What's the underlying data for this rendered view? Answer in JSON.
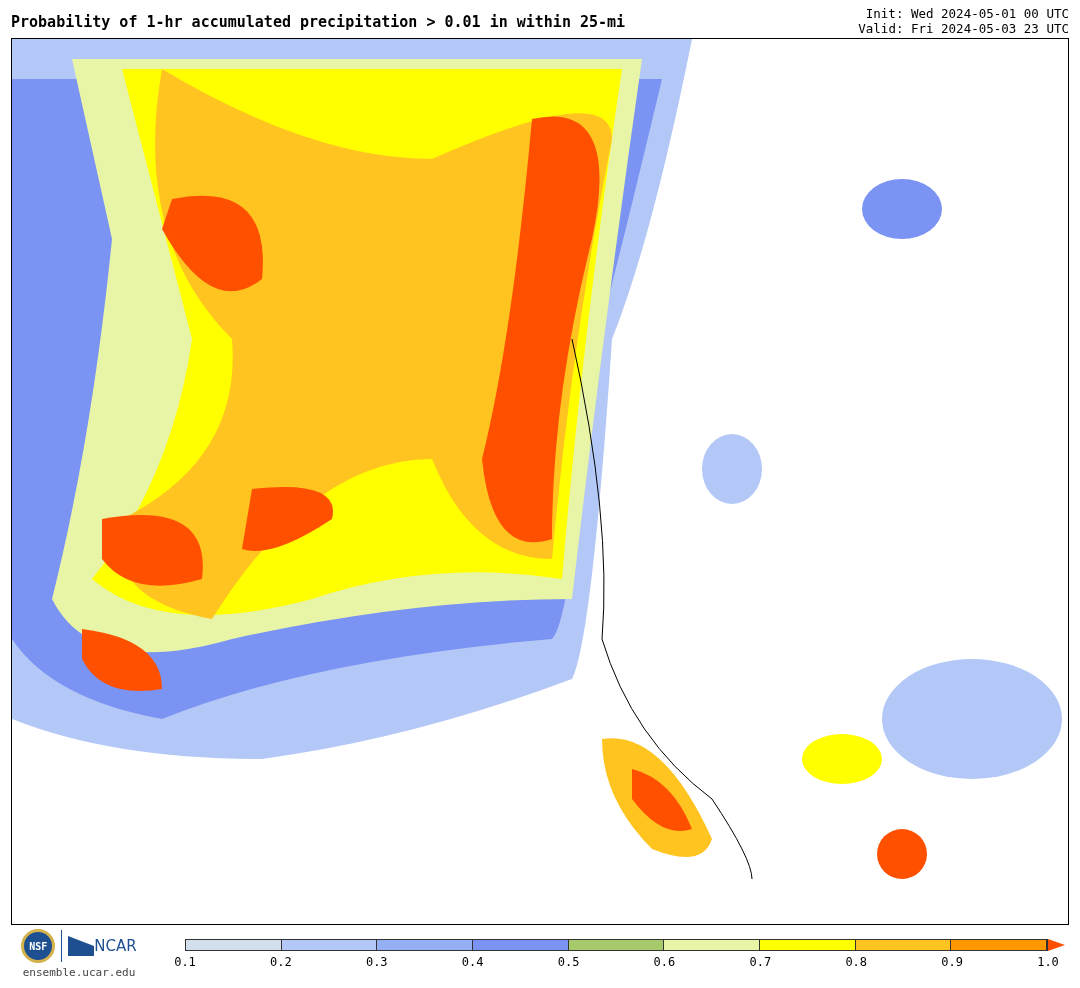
{
  "title": "Probability of 1-hr accumulated precipitation > 0.01 in within 25-mi",
  "init": "Init: Wed 2024-05-01 00 UTC",
  "valid": "Valid: Fri 2024-05-03 23 UTC",
  "logos": {
    "nsf": "NSF",
    "ncar": "NCAR",
    "site": "ensemble.ucar.edu"
  },
  "colorbar": {
    "bins": [
      {
        "kind": "box",
        "color": "#d3dfec"
      },
      {
        "kind": "box",
        "color": "#b4c8f7"
      },
      {
        "kind": "box",
        "color": "#95aff5"
      },
      {
        "kind": "box",
        "color": "#7b93f2"
      },
      {
        "kind": "box",
        "color": "#a5c96b"
      },
      {
        "kind": "box",
        "color": "#e8f5a7"
      },
      {
        "kind": "box",
        "color": "#ffff00"
      },
      {
        "kind": "box",
        "color": "#ffc41f"
      },
      {
        "kind": "box",
        "color": "#ff9800"
      },
      {
        "kind": "arrow",
        "color": "#ff5000"
      }
    ],
    "ticks": [
      "0.1",
      "0.2",
      "0.3",
      "0.4",
      "0.5",
      "0.6",
      "0.7",
      "0.8",
      "0.9",
      "1.0"
    ]
  }
}
